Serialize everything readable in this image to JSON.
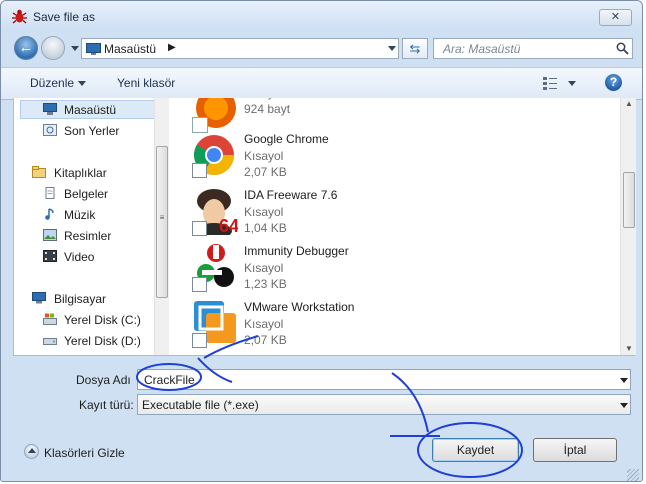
{
  "window": {
    "title": "Save file as"
  },
  "address": {
    "location": "Masaüstü",
    "search_placeholder": "Ara: Masaüstü"
  },
  "toolbar": {
    "organize": "Düzenle",
    "new_folder": "Yeni klasör"
  },
  "nav": {
    "favorites": [
      {
        "label": "Masaüstü",
        "icon": "desktop-icon"
      },
      {
        "label": "Son Yerler",
        "icon": "recent-places-icon"
      }
    ],
    "libraries": {
      "label": "Kitaplıklar",
      "items": [
        {
          "label": "Belgeler",
          "icon": "documents-icon"
        },
        {
          "label": "Müzik",
          "icon": "music-icon"
        },
        {
          "label": "Resimler",
          "icon": "pictures-icon"
        },
        {
          "label": "Video",
          "icon": "video-icon"
        }
      ]
    },
    "computer": {
      "label": "Bilgisayar",
      "items": [
        {
          "label": "Yerel Disk (C:)",
          "icon": "local-disk-c-icon"
        },
        {
          "label": "Yerel Disk (D:)",
          "icon": "local-disk-d-icon"
        }
      ]
    }
  },
  "files": [
    {
      "name": "",
      "type": "Kısayol",
      "size": "924 bayt",
      "icon": "firefox-icon"
    },
    {
      "name": "Google Chrome",
      "type": "Kısayol",
      "size": "2,07 KB",
      "icon": "chrome-icon"
    },
    {
      "name": "IDA Freeware 7.6",
      "type": "Kısayol",
      "size": "1,04 KB",
      "icon": "ida-icon"
    },
    {
      "name": "Immunity Debugger",
      "type": "Kısayol",
      "size": "1,23 KB",
      "icon": "immunity-icon"
    },
    {
      "name": "VMware Workstation",
      "type": "Kısayol",
      "size": "2,07 KB",
      "icon": "vmware-icon"
    }
  ],
  "form": {
    "filename_label": "Dosya Adı",
    "filename_value": "CrackFile",
    "type_label": "Kayıt türü:",
    "type_value": "Executable file (*.exe)"
  },
  "buttons": {
    "save": "Kaydet",
    "cancel": "İptal",
    "hide_folders": "Klasörleri Gizle"
  },
  "colors": {
    "frame": "#cfe0f3",
    "accent": "#2f6db1",
    "annotation": "#1f3fd6"
  }
}
